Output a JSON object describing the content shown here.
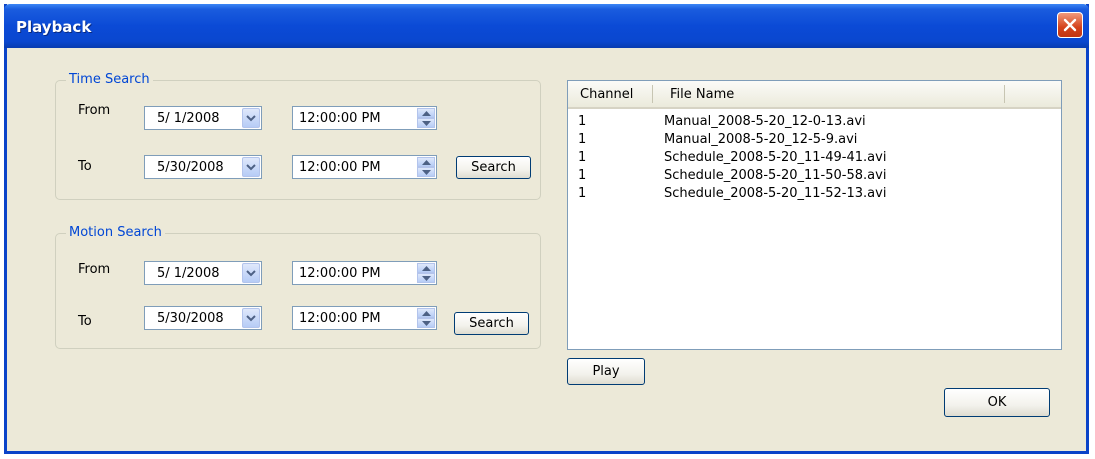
{
  "window": {
    "title": "Playback",
    "close_icon": "close-icon"
  },
  "time_search": {
    "legend": "Time Search",
    "from_label": "From",
    "to_label": "To",
    "from_date": "5/ 1/2008",
    "from_time": "12:00:00 PM",
    "to_date": "5/30/2008",
    "to_time": "12:00:00 PM",
    "search_label": "Search"
  },
  "motion_search": {
    "legend": "Motion Search",
    "from_label": "From",
    "to_label": "To",
    "from_date": "5/ 1/2008",
    "from_time": "12:00:00 PM",
    "to_date": "5/30/2008",
    "to_time": "12:00:00 PM",
    "search_label": "Search"
  },
  "file_list": {
    "columns": [
      "Channel",
      "File Name"
    ],
    "rows": [
      {
        "channel": "1",
        "file": "Manual_2008-5-20_12-0-13.avi"
      },
      {
        "channel": "1",
        "file": "Manual_2008-5-20_12-5-9.avi"
      },
      {
        "channel": "1",
        "file": "Schedule_2008-5-20_11-49-41.avi"
      },
      {
        "channel": "1",
        "file": "Schedule_2008-5-20_11-50-58.avi"
      },
      {
        "channel": "1",
        "file": "Schedule_2008-5-20_11-52-13.avi"
      }
    ]
  },
  "buttons": {
    "play_label": "Play",
    "ok_label": "OK"
  },
  "colors": {
    "titlebar": "#0a47cf",
    "legend_text": "#0046d5",
    "dialog_bg": "#ece9d8"
  }
}
